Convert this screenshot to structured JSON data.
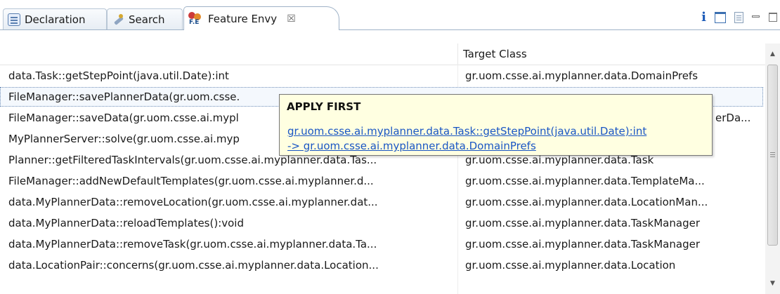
{
  "tabs": [
    {
      "label": "Declaration",
      "icon": "declaration-icon"
    },
    {
      "label": "Search",
      "icon": "search-icon"
    },
    {
      "label": "Feature Envy",
      "icon": "feature-envy-icon",
      "icon_text": "F.E",
      "close": "☒"
    }
  ],
  "view_toolbar": {
    "info_label": "i"
  },
  "table": {
    "headers": [
      "",
      "Target Class"
    ],
    "rows": [
      {
        "entity": "data.Task::getStepPoint(java.util.Date):int",
        "target": "gr.uom.csse.ai.myplanner.data.DomainPrefs"
      },
      {
        "entity": "FileManager::savePlannerData(gr.uom.csse.",
        "target": ""
      },
      {
        "entity": "FileManager::saveData(gr.uom.csse.ai.mypl",
        "target": "erDa..."
      },
      {
        "entity": "MyPlannerServer::solve(gr.uom.csse.ai.myp",
        "target": ""
      },
      {
        "entity": "Planner::getFilteredTaskIntervals(gr.uom.csse.ai.myplanner.data.Tas...",
        "target": "gr.uom.csse.ai.myplanner.data.Task"
      },
      {
        "entity": "FileManager::addNewDefaultTemplates(gr.uom.csse.ai.myplanner.d...",
        "target": "gr.uom.csse.ai.myplanner.data.TemplateMa..."
      },
      {
        "entity": "data.MyPlannerData::removeLocation(gr.uom.csse.ai.myplanner.dat...",
        "target": "gr.uom.csse.ai.myplanner.data.LocationMan..."
      },
      {
        "entity": "data.MyPlannerData::reloadTemplates():void",
        "target": "gr.uom.csse.ai.myplanner.data.TaskManager"
      },
      {
        "entity": "data.MyPlannerData::removeTask(gr.uom.csse.ai.myplanner.data.Ta...",
        "target": "gr.uom.csse.ai.myplanner.data.TaskManager"
      },
      {
        "entity": "data.LocationPair::concerns(gr.uom.csse.ai.myplanner.data.Location...",
        "target": "gr.uom.csse.ai.myplanner.data.Location"
      }
    ],
    "selected_row": 1
  },
  "tooltip": {
    "title": "APPLY FIRST",
    "line1": "gr.uom.csse.ai.myplanner.data.Task::getStepPoint(java.util.Date):int",
    "line2": "-> gr.uom.csse.ai.myplanner.data.DomainPrefs"
  },
  "colors": {
    "link": "#1a56c4",
    "tooltip_bg": "#ffffe1",
    "tab_border": "#9fb2c7"
  }
}
